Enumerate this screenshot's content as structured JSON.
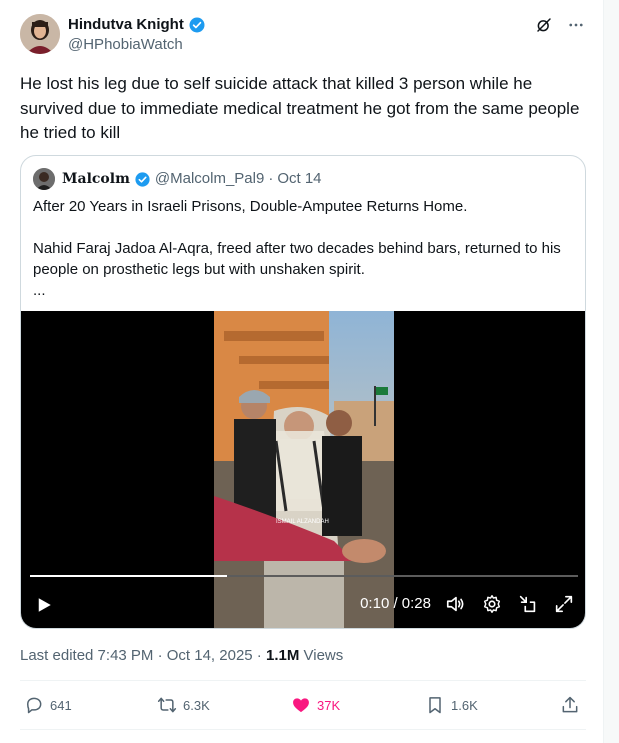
{
  "tweet": {
    "author_name": "Hindutva Knight",
    "author_handle": "@HPhobiaWatch",
    "text": "He lost his leg due to self suicide attack that killed 3 person while he survived due to immediate medical treatment he got from the same people he tried to kill"
  },
  "quote": {
    "author_name": "Malcolm",
    "author_handle": "@Malcolm_Pal9",
    "separator": "·",
    "date": "Oct 14",
    "paragraph1": "After 20 Years in Israeli Prisons, Double-Amputee Returns Home.",
    "paragraph2": "Nahid Faraj Jadoa Al-Aqra, freed after two decades behind bars, returned to his people on prosthetic legs but with unshaken spirit.",
    "ellipsis": "..."
  },
  "video": {
    "timecode": "0:10 / 0:28",
    "progress": 0.36,
    "watermark": "ISMAIL ALZANDAH"
  },
  "meta": {
    "edited": "Last edited 7:43 PM · Oct 14, 2025 · ",
    "views_count": "1.1M",
    "views_label": " Views"
  },
  "actions": {
    "replies": "641",
    "reposts": "6.3K",
    "likes": "37K",
    "bookmarks": "1.6K"
  },
  "colors": {
    "verified": "#1d9bf0",
    "like": "#f91880",
    "text_secondary": "#536471"
  },
  "icons": [
    "verified-badge-icon",
    "grok-icon",
    "more-icon",
    "play-icon",
    "volume-icon",
    "settings-icon",
    "fullscreen-exit-icon",
    "expand-icon",
    "reply-icon",
    "repost-icon",
    "heart-icon",
    "bookmark-icon",
    "share-icon"
  ]
}
